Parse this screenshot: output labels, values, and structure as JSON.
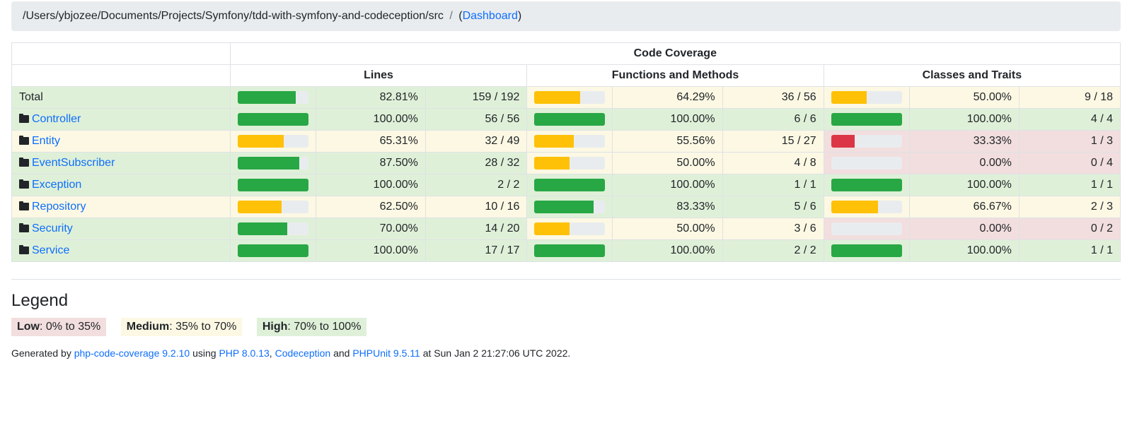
{
  "breadcrumb": {
    "path": "/Users/ybjozee/Documents/Projects/Symfony/tdd-with-symfony-and-codeception/src",
    "dashboard": "Dashboard"
  },
  "headers": {
    "coverage": "Code Coverage",
    "lines": "Lines",
    "functions": "Functions and Methods",
    "classes": "Classes and Traits"
  },
  "rows": [
    {
      "name": "Total",
      "link": false,
      "lines": {
        "pct": "82.81%",
        "ratio": "159 / 192",
        "bar": 82.81,
        "cls": "high"
      },
      "funcs": {
        "pct": "64.29%",
        "ratio": "36 / 56",
        "bar": 64.29,
        "cls": "med"
      },
      "classes": {
        "pct": "50.00%",
        "ratio": "9 / 18",
        "bar": 50.0,
        "cls": "med"
      }
    },
    {
      "name": "Controller",
      "link": true,
      "lines": {
        "pct": "100.00%",
        "ratio": "56 / 56",
        "bar": 100,
        "cls": "high"
      },
      "funcs": {
        "pct": "100.00%",
        "ratio": "6 / 6",
        "bar": 100,
        "cls": "high"
      },
      "classes": {
        "pct": "100.00%",
        "ratio": "4 / 4",
        "bar": 100,
        "cls": "high"
      }
    },
    {
      "name": "Entity",
      "link": true,
      "lines": {
        "pct": "65.31%",
        "ratio": "32 / 49",
        "bar": 65.31,
        "cls": "med"
      },
      "funcs": {
        "pct": "55.56%",
        "ratio": "15 / 27",
        "bar": 55.56,
        "cls": "med"
      },
      "classes": {
        "pct": "33.33%",
        "ratio": "1 / 3",
        "bar": 33.33,
        "cls": "low"
      }
    },
    {
      "name": "EventSubscriber",
      "link": true,
      "lines": {
        "pct": "87.50%",
        "ratio": "28 / 32",
        "bar": 87.5,
        "cls": "high"
      },
      "funcs": {
        "pct": "50.00%",
        "ratio": "4 / 8",
        "bar": 50.0,
        "cls": "med"
      },
      "classes": {
        "pct": "0.00%",
        "ratio": "0 / 4",
        "bar": 0,
        "cls": "low"
      }
    },
    {
      "name": "Exception",
      "link": true,
      "lines": {
        "pct": "100.00%",
        "ratio": "2 / 2",
        "bar": 100,
        "cls": "high"
      },
      "funcs": {
        "pct": "100.00%",
        "ratio": "1 / 1",
        "bar": 100,
        "cls": "high"
      },
      "classes": {
        "pct": "100.00%",
        "ratio": "1 / 1",
        "bar": 100,
        "cls": "high"
      }
    },
    {
      "name": "Repository",
      "link": true,
      "lines": {
        "pct": "62.50%",
        "ratio": "10 / 16",
        "bar": 62.5,
        "cls": "med"
      },
      "funcs": {
        "pct": "83.33%",
        "ratio": "5 / 6",
        "bar": 83.33,
        "cls": "high"
      },
      "classes": {
        "pct": "66.67%",
        "ratio": "2 / 3",
        "bar": 66.67,
        "cls": "med"
      }
    },
    {
      "name": "Security",
      "link": true,
      "lines": {
        "pct": "70.00%",
        "ratio": "14 / 20",
        "bar": 70,
        "cls": "high"
      },
      "funcs": {
        "pct": "50.00%",
        "ratio": "3 / 6",
        "bar": 50,
        "cls": "med"
      },
      "classes": {
        "pct": "0.00%",
        "ratio": "0 / 2",
        "bar": 0,
        "cls": "low"
      }
    },
    {
      "name": "Service",
      "link": true,
      "lines": {
        "pct": "100.00%",
        "ratio": "17 / 17",
        "bar": 100,
        "cls": "high"
      },
      "funcs": {
        "pct": "100.00%",
        "ratio": "2 / 2",
        "bar": 100,
        "cls": "high"
      },
      "classes": {
        "pct": "100.00%",
        "ratio": "1 / 1",
        "bar": 100,
        "cls": "high"
      }
    }
  ],
  "legend": {
    "title": "Legend",
    "low_label": "Low",
    "low_range": ": 0% to 35%",
    "med_label": "Medium",
    "med_range": ": 35% to 70%",
    "high_label": "High",
    "high_range": ": 70% to 100%"
  },
  "footer": {
    "generated_by": "Generated by ",
    "pcc": "php-code-coverage 9.2.10",
    "using": " using ",
    "php": "PHP 8.0.13",
    "comma": ", ",
    "codeception": "Codeception",
    "and": " and ",
    "phpunit": "PHPUnit 9.5.11",
    "at": " at Sun Jan 2 21:27:06 UTC 2022."
  }
}
